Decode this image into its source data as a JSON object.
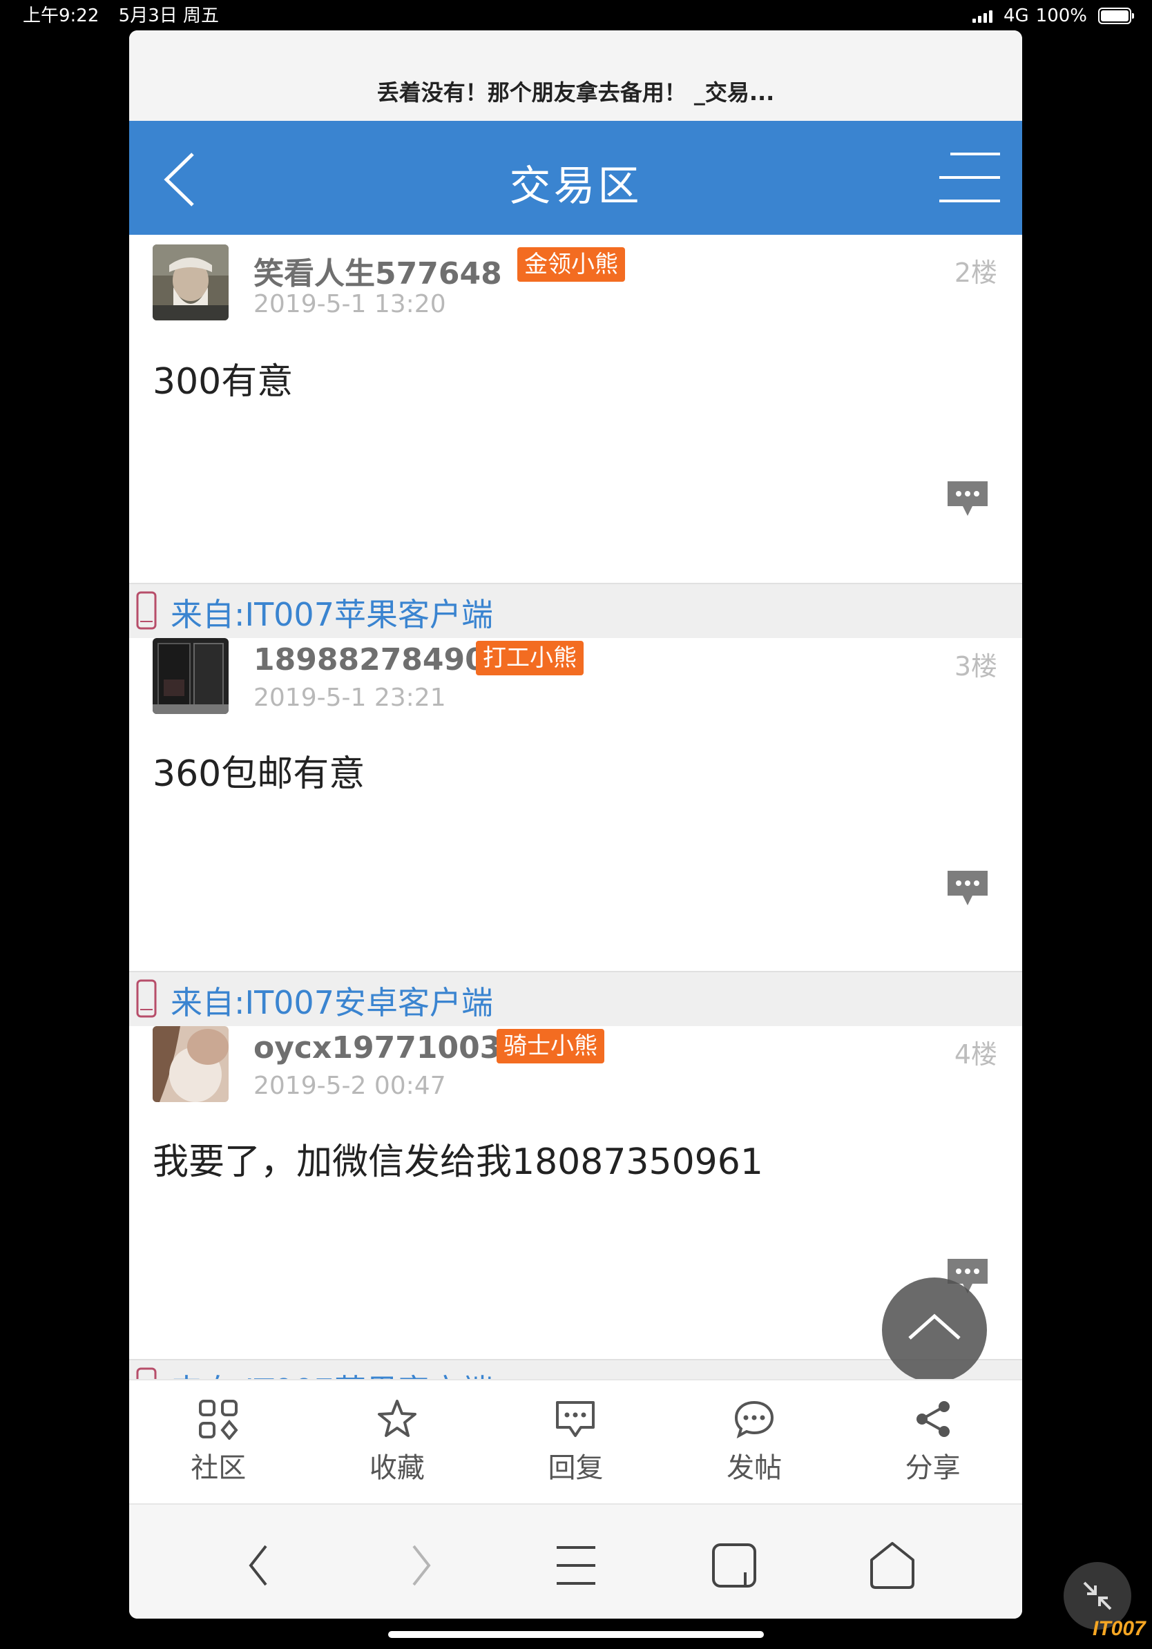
{
  "status_bar": {
    "time": "上午9:22",
    "date": "5月3日 周五",
    "network": "4G",
    "battery": "100%"
  },
  "browser": {
    "page_title": "丢着没有！那个朋友拿去备用！ _交易..."
  },
  "header": {
    "title": "交易区",
    "color": "#3a84d0"
  },
  "posts": [
    {
      "username": "笑看人生577648",
      "badge": "金领小熊",
      "time": "2019-5-1 13:20",
      "floor": "2楼",
      "body": "300有意",
      "source": "来自:IT007苹果客户端"
    },
    {
      "username": "18988278490",
      "badge": "打工小熊",
      "time": "2019-5-1 23:21",
      "floor": "3楼",
      "body": "360包邮有意",
      "source": "来自:IT007安卓客户端"
    },
    {
      "username": "oycx19771003",
      "badge": "骑士小熊",
      "time": "2019-5-2 00:47",
      "floor": "4楼",
      "body": "我要了，加微信发给我18087350961",
      "source": "来自:IT007苹果客户端"
    }
  ],
  "bottom_tabs": [
    {
      "label": "社区",
      "icon": "grid-icon"
    },
    {
      "label": "收藏",
      "icon": "star-icon"
    },
    {
      "label": "回复",
      "icon": "reply-icon"
    },
    {
      "label": "发帖",
      "icon": "post-bubble-icon"
    },
    {
      "label": "分享",
      "icon": "share-icon"
    }
  ],
  "watermark": "IT007",
  "accent_badge_color": "#f36c21"
}
